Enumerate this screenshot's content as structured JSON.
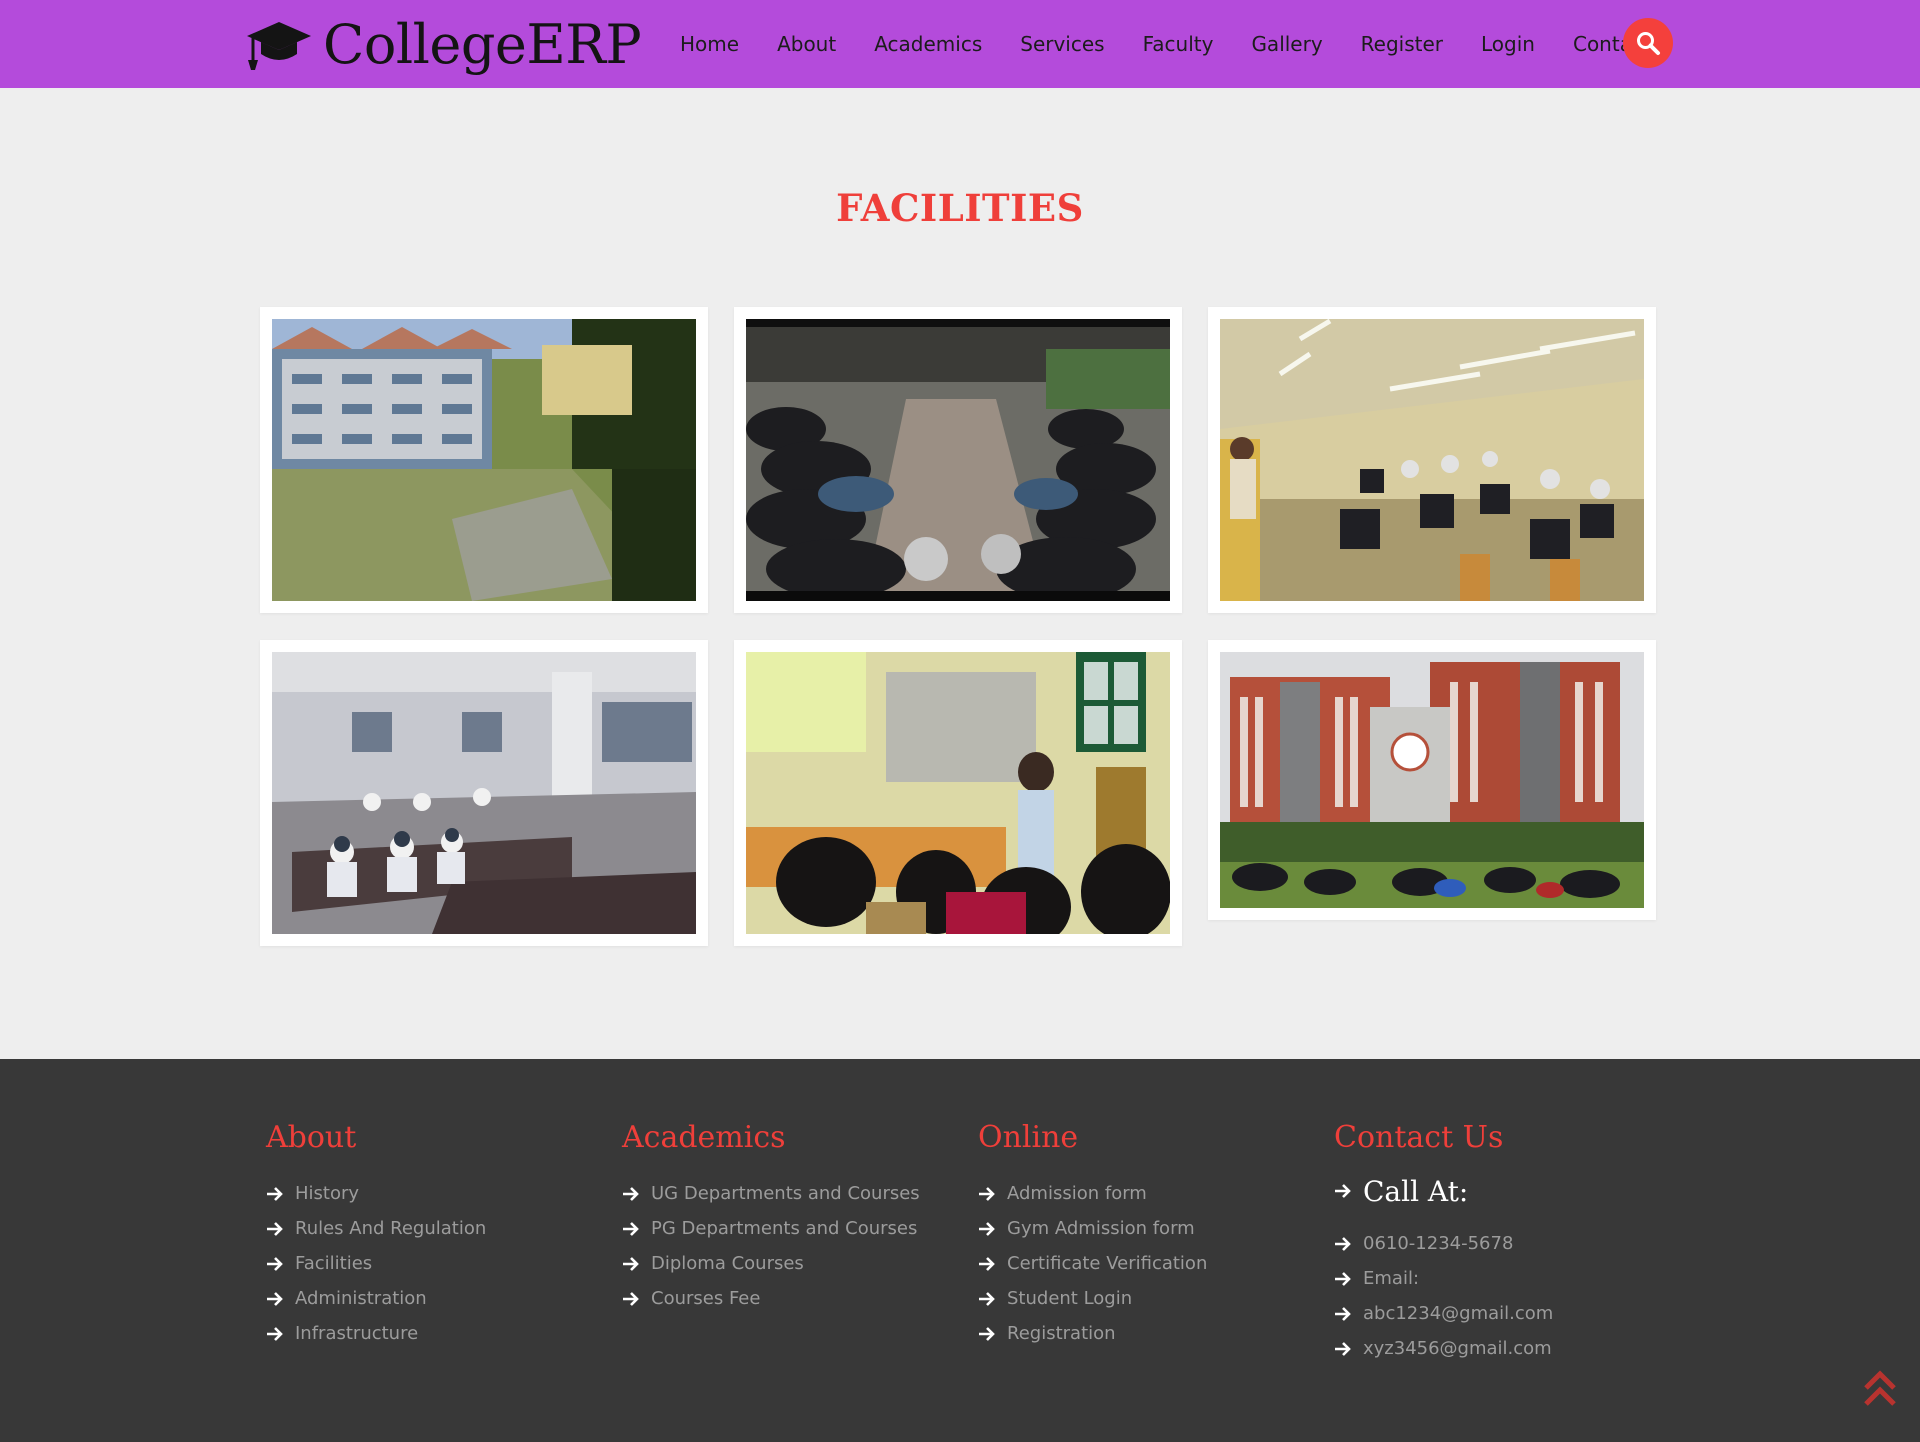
{
  "brand": {
    "name": "CollegeERP",
    "icon": "graduation-cap-icon"
  },
  "nav": {
    "items": [
      "Home",
      "About",
      "Academics",
      "Services",
      "Faculty",
      "Gallery",
      "Register",
      "Login",
      "Contact"
    ],
    "search_icon": "search-icon"
  },
  "colors": {
    "navbar": "#b44bdb",
    "accent": "#ef3f3a",
    "footer": "#383838",
    "page": "#eeeeee"
  },
  "facilities": {
    "title": "FACILITIES",
    "photos": [
      "campus-building-photo",
      "bike-parking-photo",
      "computer-lab-photo",
      "reading-room-photo",
      "seminar-photo",
      "main-building-photo"
    ]
  },
  "footer": {
    "about": {
      "title": "About",
      "links": [
        "History",
        "Rules And Regulation",
        "Facilities",
        "Administration",
        "Infrastructure"
      ]
    },
    "academics": {
      "title": "Academics",
      "links": [
        "UG Departments and Courses",
        "PG Departments and Courses",
        "Diploma Courses",
        "Courses Fee"
      ]
    },
    "online": {
      "title": "Online",
      "links": [
        "Admission form",
        "Gym Admission form",
        "Certificate Verification",
        "Student Login",
        "Registration"
      ]
    },
    "contact": {
      "title": "Contact Us",
      "call_at": "Call At:",
      "phone": "0610-1234-5678",
      "email_label": "Email:",
      "emails": [
        "abc1234@gmail.com",
        "xyz3456@gmail.com"
      ]
    }
  },
  "scroll_top_icon": "double-chevron-up-icon"
}
